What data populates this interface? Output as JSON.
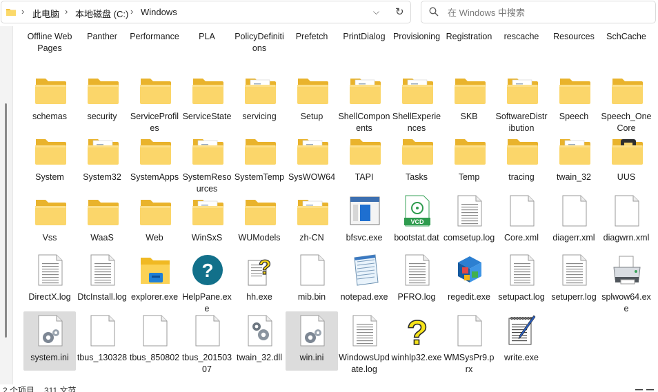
{
  "address_bar": {
    "breadcrumbs": [
      "此电脑",
      "本地磁盘 (C:)",
      "Windows"
    ]
  },
  "search": {
    "placeholder": "在 Windows 中搜索"
  },
  "status_bar": {
    "items_text": "2 个项目",
    "count_text": "311 文范"
  },
  "items": [
    {
      "name": "Offline Web Pages",
      "type": "folder-plain"
    },
    {
      "name": "Panther",
      "type": "folder-plain"
    },
    {
      "name": "Performance",
      "type": "folder-plain"
    },
    {
      "name": "PLA",
      "type": "folder-plain"
    },
    {
      "name": "PolicyDefinitions",
      "type": "folder-plain"
    },
    {
      "name": "Prefetch",
      "type": "folder-plain"
    },
    {
      "name": "PrintDialog",
      "type": "folder-plain"
    },
    {
      "name": "Provisioning",
      "type": "folder-plain"
    },
    {
      "name": "Registration",
      "type": "folder-plain"
    },
    {
      "name": "rescache",
      "type": "folder-plain"
    },
    {
      "name": "Resources",
      "type": "folder-plain"
    },
    {
      "name": "SchCache",
      "type": "folder-plain"
    },
    {
      "name": "schemas",
      "type": "folder"
    },
    {
      "name": "security",
      "type": "folder"
    },
    {
      "name": "ServiceProfiles",
      "type": "folder"
    },
    {
      "name": "ServiceState",
      "type": "folder"
    },
    {
      "name": "servicing",
      "type": "folder-doc"
    },
    {
      "name": "Setup",
      "type": "folder"
    },
    {
      "name": "ShellComponents",
      "type": "folder-doc"
    },
    {
      "name": "ShellExperiences",
      "type": "folder-doc"
    },
    {
      "name": "SKB",
      "type": "folder"
    },
    {
      "name": "SoftwareDistribution",
      "type": "folder-doc"
    },
    {
      "name": "Speech",
      "type": "folder"
    },
    {
      "name": "Speech_OneCore",
      "type": "folder"
    },
    {
      "name": "System",
      "type": "folder"
    },
    {
      "name": "System32",
      "type": "folder-doc"
    },
    {
      "name": "SystemApps",
      "type": "folder"
    },
    {
      "name": "SystemResources",
      "type": "folder-doc"
    },
    {
      "name": "SystemTemp",
      "type": "folder"
    },
    {
      "name": "SysWOW64",
      "type": "folder-doc"
    },
    {
      "name": "TAPI",
      "type": "folder"
    },
    {
      "name": "Tasks",
      "type": "folder"
    },
    {
      "name": "Temp",
      "type": "folder"
    },
    {
      "name": "tracing",
      "type": "folder"
    },
    {
      "name": "twain_32",
      "type": "folder-doc"
    },
    {
      "name": "UUS",
      "type": "folder-uus"
    },
    {
      "name": "Vss",
      "type": "folder"
    },
    {
      "name": "WaaS",
      "type": "folder"
    },
    {
      "name": "Web",
      "type": "folder"
    },
    {
      "name": "WinSxS",
      "type": "folder-doc"
    },
    {
      "name": "WUModels",
      "type": "folder"
    },
    {
      "name": "zh-CN",
      "type": "folder-doc"
    },
    {
      "name": "bfsvc.exe",
      "type": "exe-window"
    },
    {
      "name": "bootstat.dat",
      "type": "vcd"
    },
    {
      "name": "comsetup.log",
      "type": "text-file"
    },
    {
      "name": "Core.xml",
      "type": "blank-file"
    },
    {
      "name": "diagerr.xml",
      "type": "blank-file"
    },
    {
      "name": "diagwrn.xml",
      "type": "blank-file"
    },
    {
      "name": "DirectX.log",
      "type": "text-file"
    },
    {
      "name": "DtcInstall.log",
      "type": "text-file"
    },
    {
      "name": "explorer.exe",
      "type": "explorer"
    },
    {
      "name": "HelpPane.exe",
      "type": "help"
    },
    {
      "name": "hh.exe",
      "type": "hh"
    },
    {
      "name": "mib.bin",
      "type": "blank-file"
    },
    {
      "name": "notepad.exe",
      "type": "notepad"
    },
    {
      "name": "PFRO.log",
      "type": "text-file"
    },
    {
      "name": "regedit.exe",
      "type": "regedit"
    },
    {
      "name": "setupact.log",
      "type": "text-file"
    },
    {
      "name": "setuperr.log",
      "type": "text-file"
    },
    {
      "name": "splwow64.exe",
      "type": "printer"
    },
    {
      "name": "system.ini",
      "type": "ini",
      "selected": true
    },
    {
      "name": "tbus_130328",
      "type": "blank-file"
    },
    {
      "name": "tbus_850802",
      "type": "blank-file"
    },
    {
      "name": "tbus_20150307",
      "type": "blank-file"
    },
    {
      "name": "twain_32.dll",
      "type": "dll"
    },
    {
      "name": "win.ini",
      "type": "ini",
      "selected": true
    },
    {
      "name": "WindowsUpdate.log",
      "type": "text-file"
    },
    {
      "name": "winhlp32.exe",
      "type": "winhlp"
    },
    {
      "name": "WMSysPr9.prx",
      "type": "blank-file"
    },
    {
      "name": "write.exe",
      "type": "write"
    }
  ]
}
